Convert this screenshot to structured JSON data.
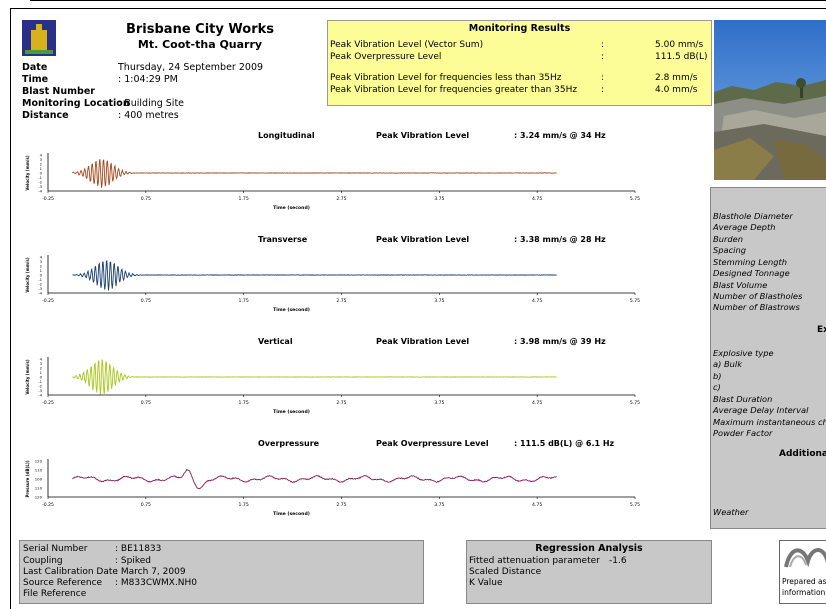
{
  "header": {
    "org_name": "Brisbane City Works",
    "site_name": "Mt. Coot-tha Quarry"
  },
  "blast_info": [
    {
      "label": "Date",
      "value": "Thursday, 24 September 2009"
    },
    {
      "label": "Time",
      "value": ": 1:04:29 PM"
    },
    {
      "label": "Blast Number",
      "value": ""
    },
    {
      "label": "Monitoring Location",
      "value": ": Building Site"
    },
    {
      "label": "Distance",
      "value": ": 400 metres"
    }
  ],
  "monitoring_results": {
    "title": "Monitoring Results",
    "rows": [
      {
        "label": "Peak Vibration Level (Vector Sum)",
        "sep": ":",
        "value": "5.00 mm/s"
      },
      {
        "label": "Peak Overpressure Level",
        "sep": ":",
        "value": "111.5 dB(L)"
      },
      {
        "label": "Peak Vibration Level for frequencies less than 35Hz",
        "sep": ":",
        "value": "2.8 mm/s"
      },
      {
        "label": "Peak Vibration Level for frequencies greater than 35Hz",
        "sep": ":",
        "value": "4.0 mm/s"
      }
    ]
  },
  "blast_design": {
    "params": [
      "Blasthole Diameter",
      "Average Depth",
      "Burden",
      "Spacing",
      "Stemming Length",
      "Designed Tonnage",
      "Blast Volume",
      "Number of Blastholes",
      "Number of Blastrows"
    ],
    "explosives_heading": "Ex",
    "explosives": [
      "Explosive type",
      "a) Bulk",
      "b)",
      "c)",
      "Blast Duration",
      "Average Delay Interval",
      "Maximum instantaneous cha",
      "Powder Factor"
    ],
    "additional_heading": "Additional",
    "weather_label": "Weather"
  },
  "chart_data": [
    {
      "type": "line",
      "title": "Longitudinal",
      "peak_label": "Peak Vibration Level",
      "peak_value": ": 3.24 mm/s @ 34 Hz",
      "xlabel": "Time (second)",
      "ylabel": "Velocity (mm/s)",
      "x_ticks": [
        "-0.25",
        "0.75",
        "1.75",
        "2.75",
        "3.75",
        "4.75",
        "5.75"
      ],
      "y_ticks": [
        "4",
        "3",
        "2",
        "1",
        "0",
        "-1",
        "-2",
        "-3",
        "-4"
      ],
      "xlim": [
        -0.25,
        5.75
      ],
      "ylim": [
        -4,
        4
      ],
      "record_end": 4.95,
      "color": "#a5481e",
      "peak_amplitude": 3.24,
      "peak_time": 0.3
    },
    {
      "type": "line",
      "title": "Transverse",
      "peak_label": "Peak Vibration Level",
      "peak_value": ": 3.38 mm/s @ 28 Hz",
      "xlabel": "Time (second)",
      "ylabel": "Velocity (mm/s)",
      "x_ticks": [
        "-0.25",
        "0.75",
        "1.75",
        "2.75",
        "3.75",
        "4.75",
        "5.75"
      ],
      "y_ticks": [
        "4",
        "3",
        "2",
        "1",
        "0",
        "-1",
        "-2",
        "-3",
        "-4"
      ],
      "xlim": [
        -0.25,
        5.75
      ],
      "ylim": [
        -4,
        4
      ],
      "record_end": 4.95,
      "color": "#1b3f6e",
      "peak_amplitude": 3.38,
      "peak_time": 0.35
    },
    {
      "type": "line",
      "title": "Vertical",
      "peak_label": "Peak Vibration Level",
      "peak_value": ": 3.98 mm/s @ 39 Hz",
      "xlabel": "Time (second)",
      "ylabel": "Velocity (mm/s)",
      "x_ticks": [
        "-0.25",
        "0.75",
        "1.75",
        "2.75",
        "3.75",
        "4.75",
        "5.75"
      ],
      "y_ticks": [
        "4",
        "3",
        "2",
        "1",
        "0",
        "-1",
        "-2",
        "-3",
        "-4"
      ],
      "xlim": [
        -0.25,
        5.75
      ],
      "ylim": [
        -4,
        4
      ],
      "record_end": 4.95,
      "color": "#a8c81e",
      "peak_amplitude": 3.98,
      "peak_time": 0.3
    },
    {
      "type": "line",
      "title": "Overpressure",
      "peak_label": "Peak Overpressure Level",
      "peak_value": ": 111.5 dB(L) @ 6.1 Hz",
      "xlabel": "Time (second)",
      "ylabel": "Pressure (dB(L))",
      "x_ticks": [
        "-0.25",
        "0.75",
        "1.75",
        "2.75",
        "3.75",
        "4.75",
        "5.75"
      ],
      "y_ticks": [
        "120",
        "110",
        "100",
        "110",
        "120"
      ],
      "xlim": [
        -0.25,
        5.75
      ],
      "ylim": [
        -4,
        4
      ],
      "record_end": 4.95,
      "color": "#8a1f57",
      "peak_amplitude": 3.0,
      "peak_time": 1.2
    }
  ],
  "equipment": [
    {
      "label": "Serial Number",
      "value": ": BE11833"
    },
    {
      "label": "Coupling",
      "value": ": Spiked"
    },
    {
      "label": "Last Calibration Date",
      "value": ": March 7, 2009"
    },
    {
      "label": "Source Reference",
      "value": ": M833CWMX.NH0"
    },
    {
      "label": "File Reference",
      "value": ""
    }
  ],
  "regression": {
    "title": "Regression Analysis",
    "rows": [
      {
        "label": "Fitted attenuation parameter",
        "value": "-1.6"
      },
      {
        "label": "Scaled Distance",
        "value": ""
      },
      {
        "label": "K Value",
        "value": ""
      }
    ]
  },
  "prepared": {
    "line1": "Prepared as a",
    "line2": "information"
  }
}
